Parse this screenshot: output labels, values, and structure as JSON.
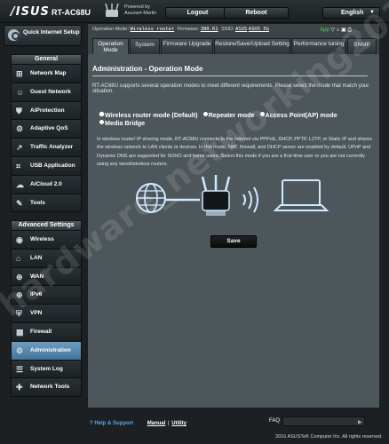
{
  "header": {
    "brand": "/ISUS",
    "model": "RT-AC68U",
    "powered_by": "Powered by",
    "firmware_name": "Asuswrt-Merlin",
    "logout_label": "Logout",
    "reboot_label": "Reboot",
    "language": "English"
  },
  "sidebar": {
    "quick_setup_label": "Quick Internet Setup",
    "general_label": "General",
    "general_items": [
      {
        "label": "Network Map",
        "icon": "network-map-icon"
      },
      {
        "label": "Guest Network",
        "icon": "guest-network-icon"
      },
      {
        "label": "AiProtection",
        "icon": "shield-icon"
      },
      {
        "label": "Adaptive QoS",
        "icon": "qos-icon"
      },
      {
        "label": "Traffic Analyzer",
        "icon": "traffic-analyzer-icon"
      },
      {
        "label": "USB Application",
        "icon": "usb-icon"
      },
      {
        "label": "AiCloud 2.0",
        "icon": "cloud-icon"
      },
      {
        "label": "Tools",
        "icon": "tools-icon"
      }
    ],
    "advanced_label": "Advanced Settings",
    "advanced_items": [
      {
        "label": "Wireless",
        "icon": "wireless-icon"
      },
      {
        "label": "LAN",
        "icon": "lan-icon"
      },
      {
        "label": "WAN",
        "icon": "globe-icon"
      },
      {
        "label": "IPv6",
        "icon": "ipv6-icon"
      },
      {
        "label": "VPN",
        "icon": "vpn-icon"
      },
      {
        "label": "Firewall",
        "icon": "firewall-icon"
      },
      {
        "label": "Administration",
        "icon": "administration-icon",
        "active": true
      },
      {
        "label": "System Log",
        "icon": "system-log-icon"
      },
      {
        "label": "Network Tools",
        "icon": "network-tools-icon"
      }
    ]
  },
  "status": {
    "op_mode_label": "Operation Mode:",
    "op_mode_value": "Wireless router",
    "firmware_label": "Firmware:",
    "firmware_value": "380.61",
    "ssid_label": "SSID:",
    "ssid_1": "ASUS",
    "ssid_2": "ASUS_5G",
    "app_label": "App"
  },
  "tabs": [
    {
      "label": "Operation Mode",
      "active": true
    },
    {
      "label": "System"
    },
    {
      "label": "Firmware Upgrade"
    },
    {
      "label": "Restore/Save/Upload Setting"
    },
    {
      "label": "Performance tuning"
    },
    {
      "label": "SNMP"
    }
  ],
  "page": {
    "title": "Administration - Operation Mode",
    "intro": "RT-AC68U supports several operation modes to meet different requirements. Please select the mode that match your situation.",
    "modes": [
      {
        "label": "Wireless router mode (Default)",
        "checked": true
      },
      {
        "label": "Repeater mode"
      },
      {
        "label": "Access Point(AP) mode"
      },
      {
        "label": "Media Bridge"
      }
    ],
    "mode_description": "In wireless router/ IP sharing mode, RT-AC68U connects to the Internet via PPPoE, DHCP, PPTP, L2TP, or Static IP and shares the wireless network to LAN clients or devices. In this mode, NAT, firewall, and DHCP server are enabled by default. UPnP and Dynamic DNS are supported for SOHO and home users. Select this mode if you are a first-time user or you are not currently using any wired/wireless routers.",
    "save_label": "Save"
  },
  "footer": {
    "help_label": "Help & Support",
    "manual_label": "Manual",
    "separator": "|",
    "utility_label": "Utility",
    "faq_label": "FAQ",
    "copyright": "2016 ASUSTeK Computer Inc. All rights reserved."
  },
  "watermark": "hardware_networking2016",
  "colors": {
    "active_menu": "#5a8db3",
    "link_blue": "#5ea6e0",
    "app_green": "#55d06a"
  }
}
